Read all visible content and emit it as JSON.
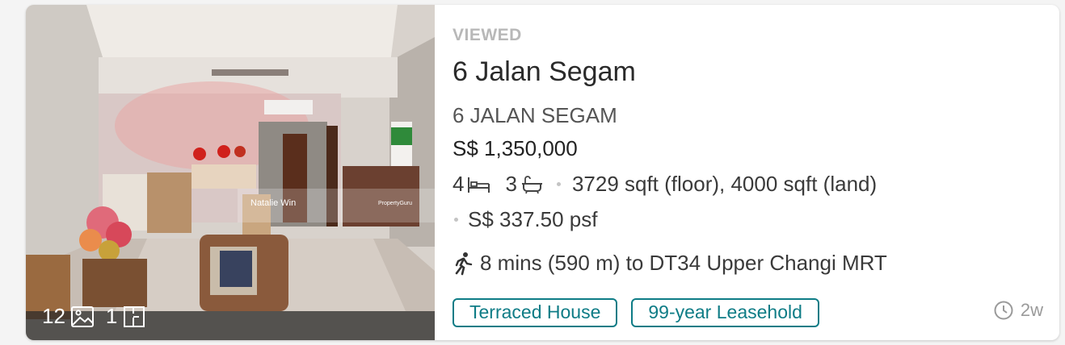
{
  "listing": {
    "status": "VIEWED",
    "title": "6 Jalan Segam",
    "address": "6 JALAN SEGAM",
    "price": "S$ 1,350,000",
    "bedrooms": "4",
    "bathrooms": "3",
    "area": "3729 sqft (floor), 4000 sqft (land)",
    "psf": "S$ 337.50 psf",
    "mrt": "8 mins (590 m) to DT34 Upper Changi MRT",
    "tags": [
      "Terraced House",
      "99-year Leasehold"
    ],
    "posted_age": "2w"
  },
  "photo": {
    "image_count": "12",
    "floorplan_count": "1",
    "watermark_agent": "Natalie Win",
    "watermark_brand": "PropertyGuru"
  },
  "icons": {
    "bed": "bed-icon",
    "bath": "bath-icon",
    "walk": "walk-icon",
    "clock": "clock-icon",
    "gallery": "image-icon",
    "floorplan": "floorplan-icon"
  },
  "colors": {
    "accent": "#0e7c86",
    "viewed": "#b8b8b8"
  }
}
